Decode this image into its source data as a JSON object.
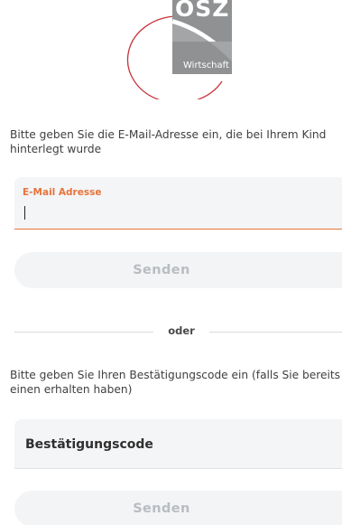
{
  "logo": {
    "top_text": "OSZ",
    "bottom_text": "Wirtschaft"
  },
  "email_section": {
    "instruction": "Bitte geben Sie die E-Mail-Adresse ein, die bei Ihrem Kind hinterlegt wurde",
    "field_label": "E-Mail Adresse",
    "field_value": "",
    "submit_label": "Senden"
  },
  "divider": {
    "label": "oder"
  },
  "code_section": {
    "instruction": "Bitte geben Sie Ihren Bestätigungscode ein (falls Sie bereits einen erhalten haben)",
    "field_placeholder": "Bestätigungscode",
    "field_value": "",
    "submit_label": "Senden"
  },
  "colors": {
    "accent": "#e8743b",
    "logo_gray": "#8f9193",
    "logo_red": "#c8323c",
    "button_bg": "#f2f4f6",
    "button_text_disabled": "#b9bcc1",
    "field_bg": "#f3f5f7"
  }
}
